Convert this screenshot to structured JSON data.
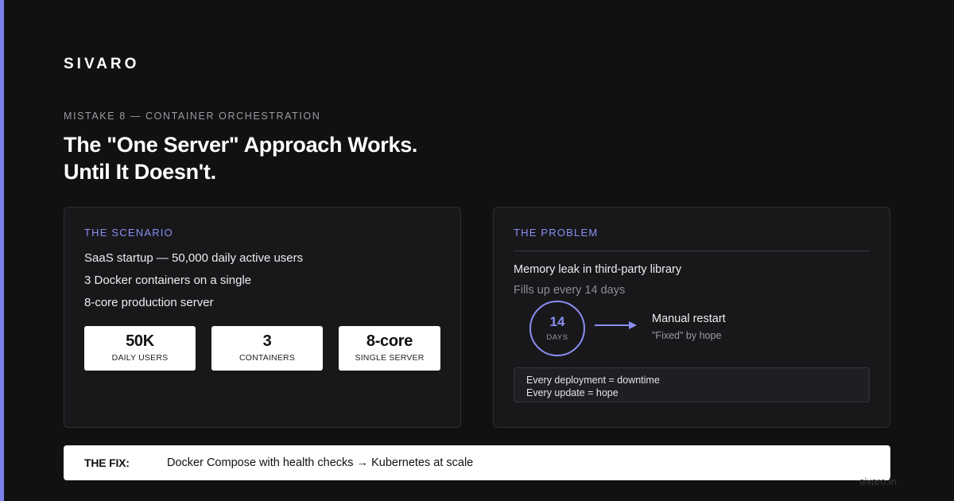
{
  "brand": "SIVARO",
  "eyebrow": "MISTAKE 8 — CONTAINER ORCHESTRATION",
  "headline": {
    "line1": "The \"One Server\" Approach Works.",
    "line2": "Until It Doesn't."
  },
  "scenario": {
    "label": "THE SCENARIO",
    "lines": [
      "SaaS startup — 50,000 daily active users",
      "3 Docker containers on a single",
      "8-core production server"
    ],
    "stats": [
      {
        "value": "50K",
        "caption": "DAILY USERS"
      },
      {
        "value": "3",
        "caption": "CONTAINERS"
      },
      {
        "value": "8-core",
        "caption": "SINGLE SERVER"
      }
    ]
  },
  "problem": {
    "label": "THE PROBLEM",
    "title": "Memory leak in third-party library",
    "subtitle": "Fills up every 14 days",
    "ring": {
      "value": "14",
      "unit": "DAYS"
    },
    "restart_title": "Manual restart",
    "restart_sub": "\"Fixed\" by hope",
    "notes": [
      "Every deployment = downtime",
      "Every update = hope"
    ]
  },
  "fix": {
    "label": "THE FIX:",
    "text": "Docker Compose with health checks → Kubernetes at scale"
  },
  "footer_url": "sivaro.in",
  "colors": {
    "background": "#111112",
    "accent": "#8b8ef2",
    "card": "#18181b",
    "fix_bar": "#ffffff"
  }
}
